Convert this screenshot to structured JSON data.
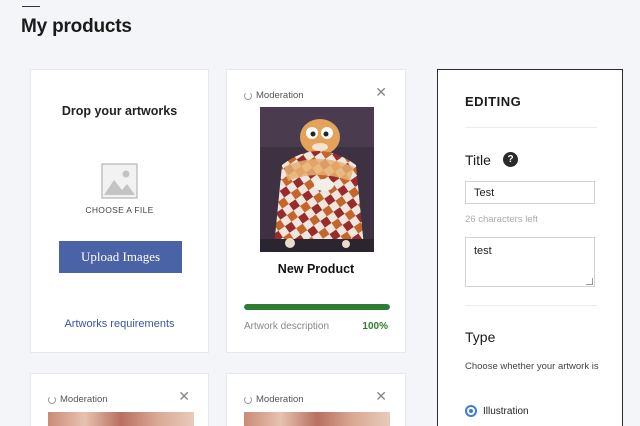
{
  "page": {
    "title": "My products"
  },
  "drop_zone": {
    "title": "Drop your artworks",
    "choose_file": "CHOOSE A FILE",
    "upload_button": "Upload Images",
    "requirements_link": "Artworks requirements"
  },
  "products": [
    {
      "status": "Moderation",
      "name": "New Product",
      "progress": 1.0,
      "progress_label": "Artwork description",
      "progress_value": "100%"
    },
    {
      "status": "Moderation"
    },
    {
      "status": "Moderation"
    }
  ],
  "editing": {
    "heading": "EDITING",
    "title_label": "Title",
    "help_icon": "?",
    "title_value": "Test",
    "chars_left": "26 characters left",
    "description_value": "test",
    "type_label": "Type",
    "type_help": "Choose whether your artwork is",
    "type_option": "Illustration"
  },
  "colors": {
    "accent": "#4a62a6",
    "link": "#3a56a0",
    "progress": "#2e7d32",
    "radio": "#3b7be0"
  }
}
